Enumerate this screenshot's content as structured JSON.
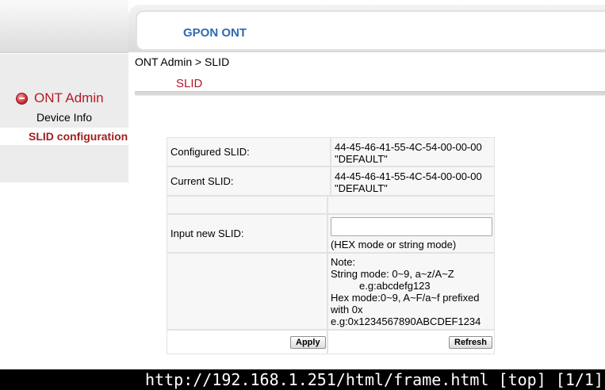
{
  "header": {
    "title": "GPON ONT"
  },
  "breadcrumb": "ONT Admin > SLID",
  "page_heading": "SLID",
  "sidebar": {
    "menu_title": "ONT Admin",
    "menu_icon": "collapse-minus-icon",
    "items": [
      {
        "label": "Device Info"
      },
      {
        "label": "SLID configuration"
      }
    ]
  },
  "form": {
    "configured": {
      "label": "Configured SLID:",
      "value_line1": "44-45-46-41-55-4C-54-00-00-00",
      "value_line2": "\"DEFAULT\""
    },
    "current": {
      "label": "Current SLID:",
      "value_line1": "44-45-46-41-55-4C-54-00-00-00",
      "value_line2": "\"DEFAULT\""
    },
    "new_slid": {
      "label": "Input new SLID:",
      "value": "",
      "hint": "(HEX mode or string mode)"
    },
    "note": {
      "line1": "Note:",
      "line2": "String mode: 0~9, a~z/A~Z",
      "line3": "e.g:abcdefg123",
      "line4": "Hex mode:0~9, A~F/a~f prefixed",
      "line5": "with 0x",
      "line6": "e.g:0x1234567890ABCDEF1234"
    },
    "apply_label": "Apply",
    "refresh_label": "Refresh"
  },
  "statusbar": {
    "text": "http://192.168.1.251/html/frame.html [top] [1/1]"
  }
}
